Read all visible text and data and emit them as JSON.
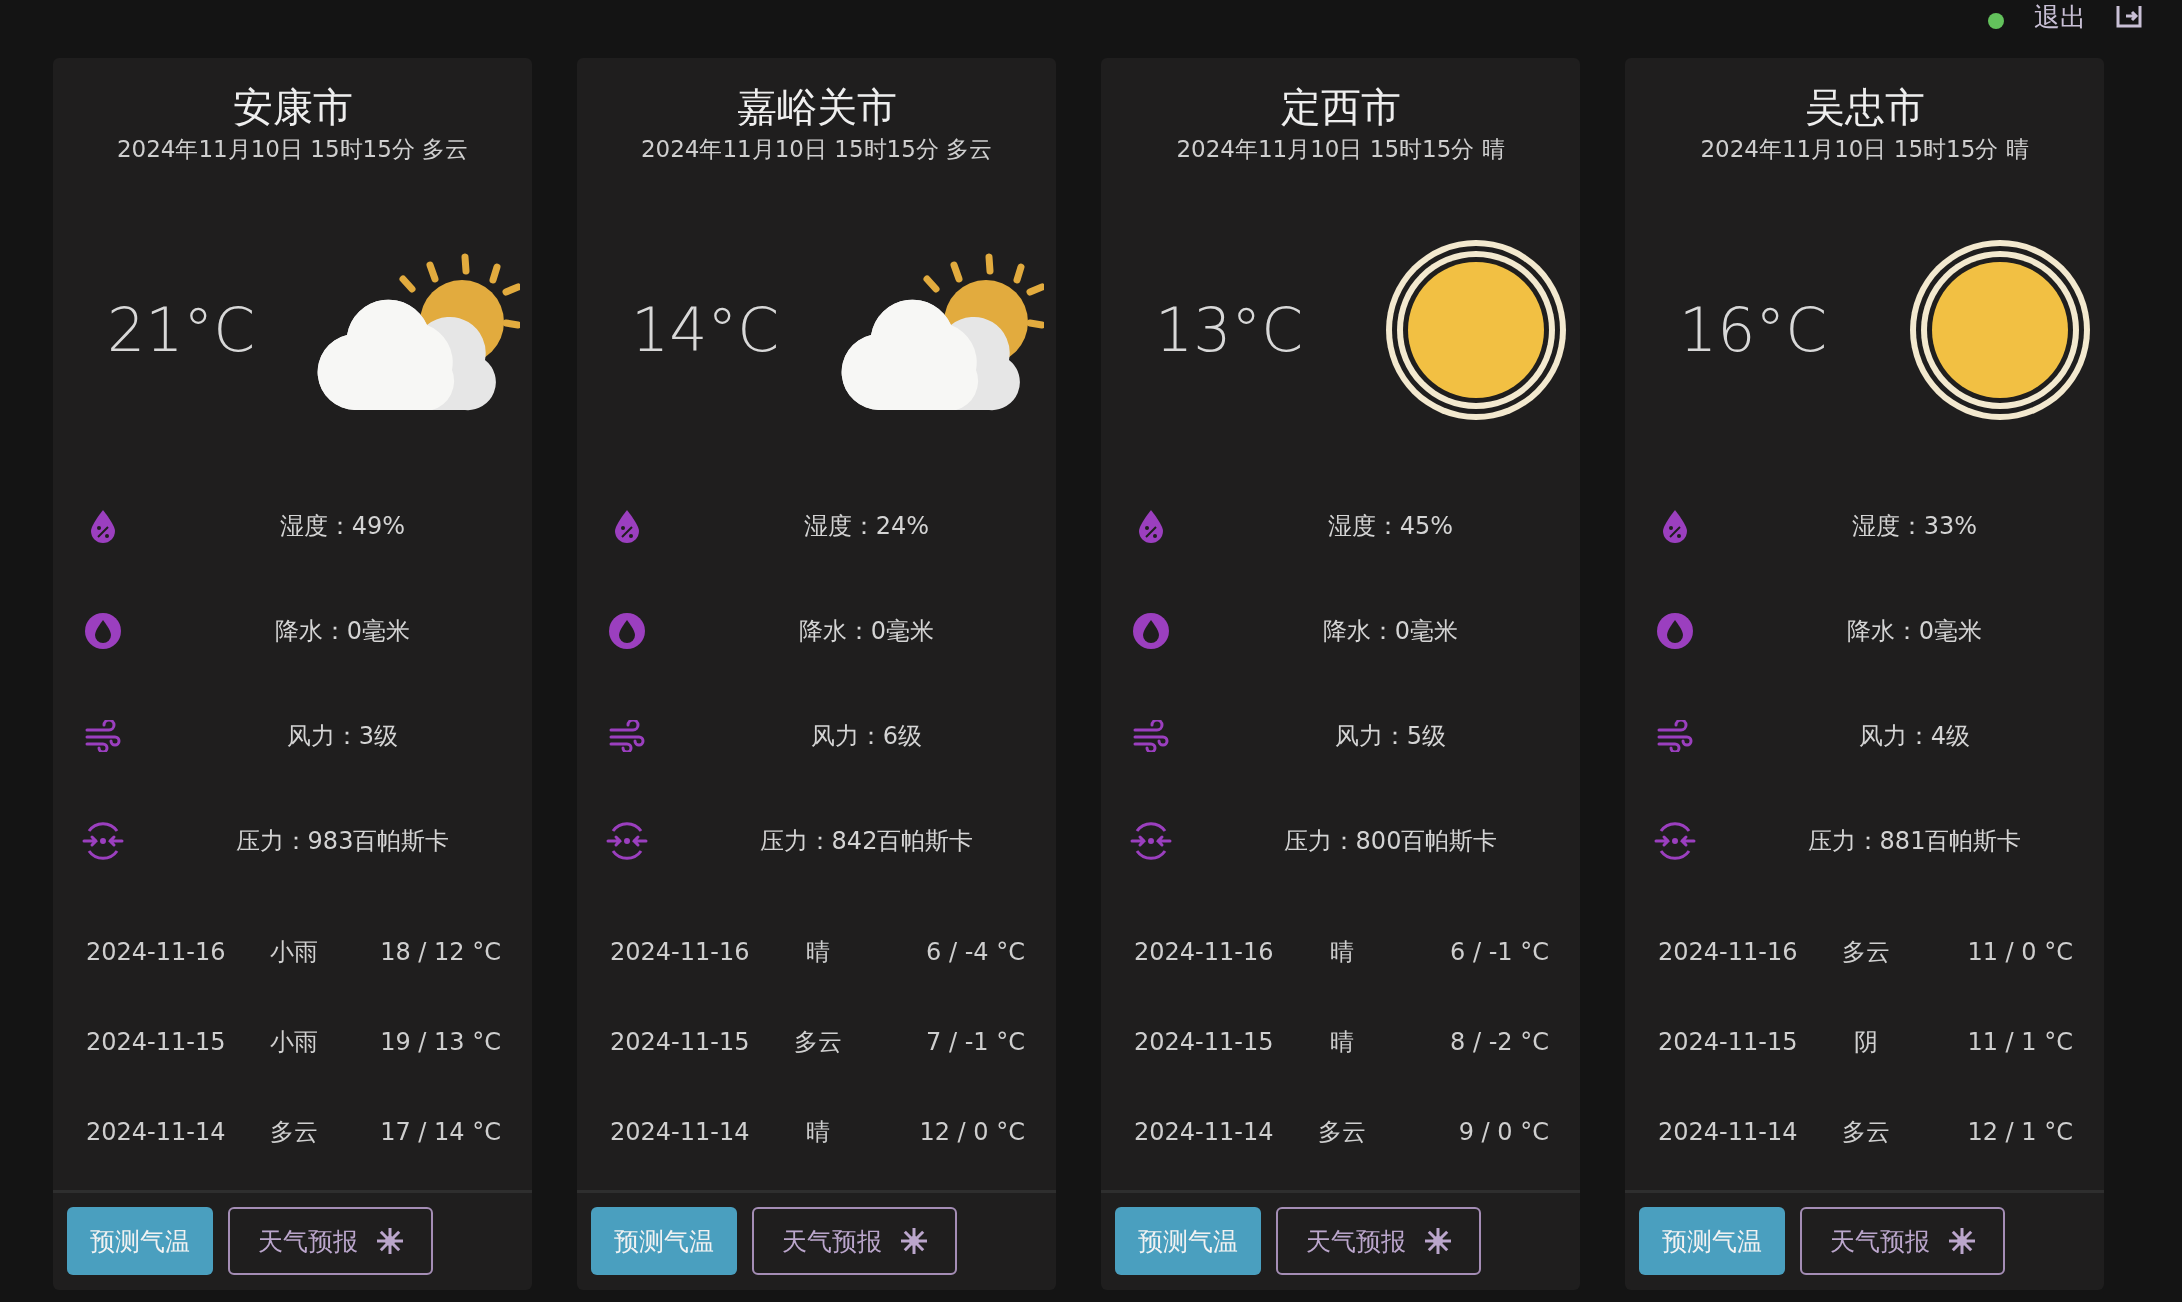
{
  "top_bar": {
    "logout_label": "退出"
  },
  "cards": [
    {
      "city": "安康市",
      "datetime": "2024年11月10日 15时15分 多云",
      "temperature": "21°C",
      "weather_icon": {
        "kind": "partly-cloudy"
      },
      "stats": [
        {
          "kind": "humidity",
          "text": "湿度：49%"
        },
        {
          "kind": "precipitation",
          "text": "降水：0毫米"
        },
        {
          "kind": "wind",
          "text": "风力：3级"
        },
        {
          "kind": "pressure",
          "text": "压力：983百帕斯卡"
        }
      ],
      "forecast": [
        {
          "date": "2024-11-16",
          "weather": "小雨",
          "temps": "18 / 12 °C"
        },
        {
          "date": "2024-11-15",
          "weather": "小雨",
          "temps": "19 / 13 °C"
        },
        {
          "date": "2024-11-14",
          "weather": "多云",
          "temps": "17 / 14 °C"
        }
      ],
      "buttons": {
        "predict": "预测气温",
        "forecast": "天气预报"
      }
    },
    {
      "city": "嘉峪关市",
      "datetime": "2024年11月10日 15时15分 多云",
      "temperature": "14°C",
      "weather_icon": {
        "kind": "partly-cloudy"
      },
      "stats": [
        {
          "kind": "humidity",
          "text": "湿度：24%"
        },
        {
          "kind": "precipitation",
          "text": "降水：0毫米"
        },
        {
          "kind": "wind",
          "text": "风力：6级"
        },
        {
          "kind": "pressure",
          "text": "压力：842百帕斯卡"
        }
      ],
      "forecast": [
        {
          "date": "2024-11-16",
          "weather": "晴",
          "temps": "6 / -4 °C"
        },
        {
          "date": "2024-11-15",
          "weather": "多云",
          "temps": "7 / -1 °C"
        },
        {
          "date": "2024-11-14",
          "weather": "晴",
          "temps": "12 / 0 °C"
        }
      ],
      "buttons": {
        "predict": "预测气温",
        "forecast": "天气预报"
      }
    },
    {
      "city": "定西市",
      "datetime": "2024年11月10日 15时15分 晴",
      "temperature": "13°C",
      "weather_icon": {
        "kind": "sunny"
      },
      "stats": [
        {
          "kind": "humidity",
          "text": "湿度：45%"
        },
        {
          "kind": "precipitation",
          "text": "降水：0毫米"
        },
        {
          "kind": "wind",
          "text": "风力：5级"
        },
        {
          "kind": "pressure",
          "text": "压力：800百帕斯卡"
        }
      ],
      "forecast": [
        {
          "date": "2024-11-16",
          "weather": "晴",
          "temps": "6 / -1 °C"
        },
        {
          "date": "2024-11-15",
          "weather": "晴",
          "temps": "8 / -2 °C"
        },
        {
          "date": "2024-11-14",
          "weather": "多云",
          "temps": "9 / 0 °C"
        }
      ],
      "buttons": {
        "predict": "预测气温",
        "forecast": "天气预报"
      }
    },
    {
      "city": "吴忠市",
      "datetime": "2024年11月10日 15时15分 晴",
      "temperature": "16°C",
      "weather_icon": {
        "kind": "sunny"
      },
      "stats": [
        {
          "kind": "humidity",
          "text": "湿度：33%"
        },
        {
          "kind": "precipitation",
          "text": "降水：0毫米"
        },
        {
          "kind": "wind",
          "text": "风力：4级"
        },
        {
          "kind": "pressure",
          "text": "压力：881百帕斯卡"
        }
      ],
      "forecast": [
        {
          "date": "2024-11-16",
          "weather": "多云",
          "temps": "11 / 0 °C"
        },
        {
          "date": "2024-11-15",
          "weather": "阴",
          "temps": "11 / 1 °C"
        },
        {
          "date": "2024-11-14",
          "weather": "多云",
          "temps": "12 / 1 °C"
        }
      ],
      "buttons": {
        "predict": "预测气温",
        "forecast": "天气预报"
      }
    }
  ]
}
